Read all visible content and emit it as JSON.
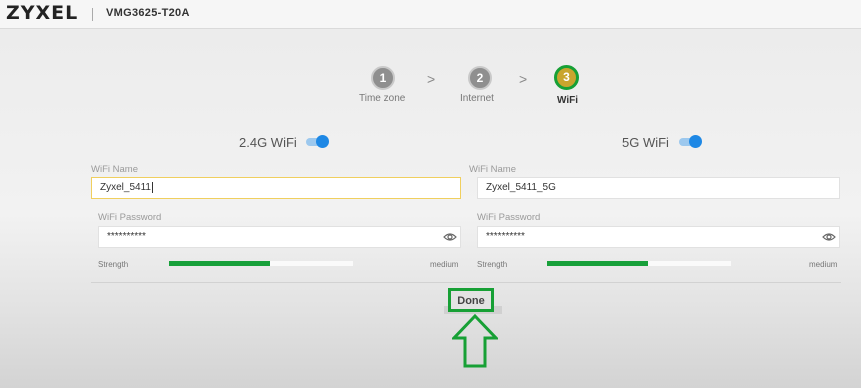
{
  "header": {
    "brand": "ZYXEL",
    "model": "VMG3625-T20A"
  },
  "steps": [
    {
      "number": "1",
      "label": "Time zone",
      "active": false
    },
    {
      "number": "2",
      "label": "Internet",
      "active": false
    },
    {
      "number": "3",
      "label": "WiFi",
      "active": true
    }
  ],
  "chevron": ">",
  "wifi24": {
    "title": "2.4G WiFi",
    "enabled": true,
    "name_label": "WiFi Name",
    "name_value": "Zyxel_5411",
    "password_label": "WiFi Password",
    "password_value": "**********",
    "strength_label": "Strength",
    "strength_value": "medium",
    "strength_level": 0.55
  },
  "wifi5": {
    "title": "5G WiFi",
    "enabled": true,
    "name_label": "WiFi Name",
    "name_value": "Zyxel_5411_5G",
    "password_label": "WiFi Password",
    "password_value": "**********",
    "strength_label": "Strength",
    "strength_value": "medium",
    "strength_level": 0.55
  },
  "done_label": "Done",
  "colors": {
    "accent_green": "#17a035",
    "toggle_blue": "#1e88e5",
    "focus_yellow": "#f0cf5e"
  },
  "icons": {
    "eye": "eye-icon",
    "annotation_arrow": "up-arrow-icon"
  }
}
